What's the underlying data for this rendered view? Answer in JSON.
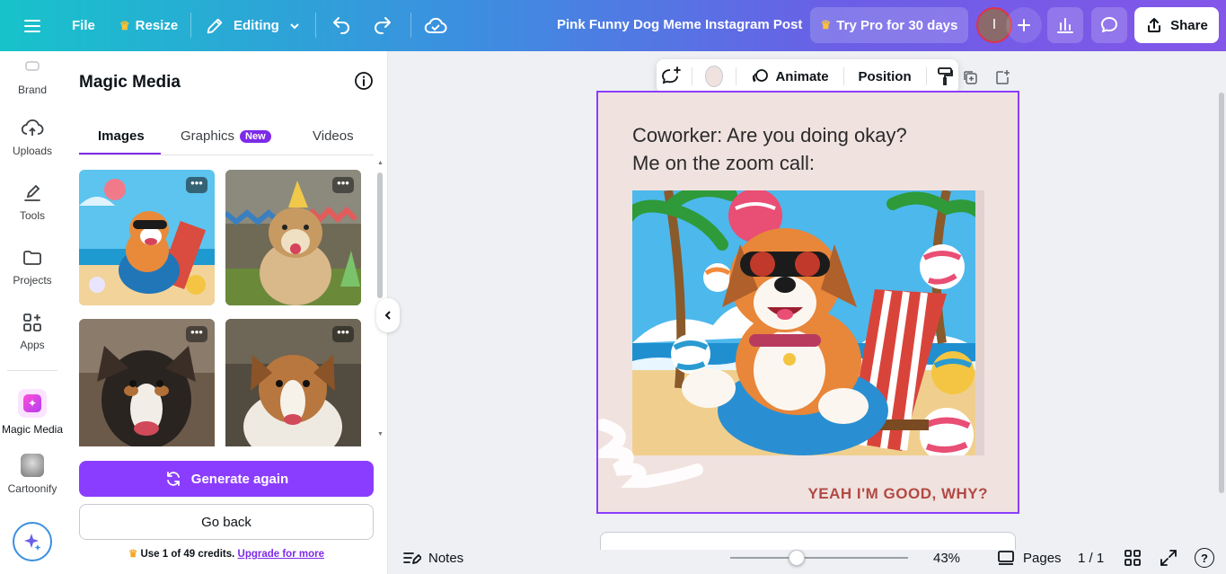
{
  "header": {
    "file": "File",
    "resize": "Resize",
    "editing": "Editing",
    "doc_title": "Pink Funny Dog Meme Instagram Post",
    "try_pro": "Try Pro for 30 days",
    "avatar_initial": "I",
    "share": "Share"
  },
  "rail": {
    "items": [
      {
        "label": "Brand"
      },
      {
        "label": "Uploads"
      },
      {
        "label": "Tools"
      },
      {
        "label": "Projects"
      },
      {
        "label": "Apps"
      },
      {
        "label": "Magic Media"
      },
      {
        "label": "Cartoonify"
      }
    ]
  },
  "panel": {
    "title": "Magic Media",
    "tabs": [
      {
        "label": "Images"
      },
      {
        "label": "Graphics",
        "badge": "New"
      },
      {
        "label": "Videos"
      }
    ],
    "more_glyph": "•••",
    "generate_again": "Generate again",
    "go_back": "Go back",
    "credits_text": "Use 1 of 49 credits.",
    "credits_link": "Upgrade for more"
  },
  "context_toolbar": {
    "animate": "Animate",
    "position": "Position"
  },
  "design": {
    "line1": "Coworker: Are you doing okay?",
    "line2": "Me on the zoom call:",
    "caption": "YEAH I'M GOOD, WHY?"
  },
  "footer": {
    "notes": "Notes",
    "zoom": "43%",
    "pages": "Pages",
    "page_count": "1 / 1",
    "help": "?"
  },
  "colors": {
    "accent": "#8b3dff",
    "caption": "#b24944",
    "page_bg": "#f0e2df"
  }
}
